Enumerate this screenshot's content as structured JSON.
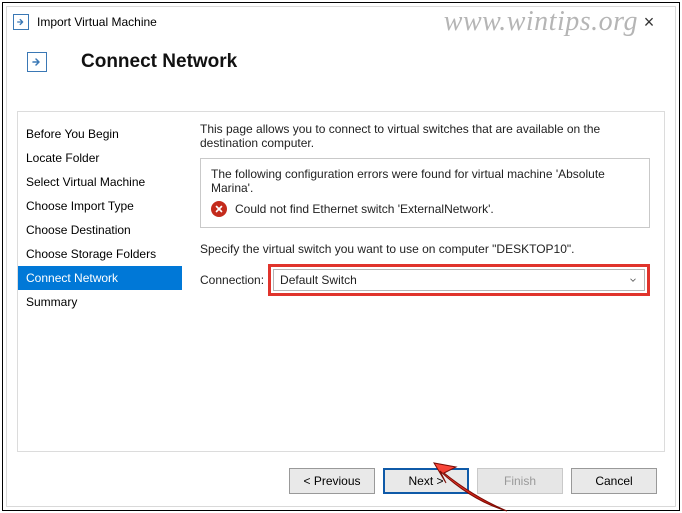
{
  "window": {
    "title": "Import Virtual Machine",
    "page_heading": "Connect Network"
  },
  "sidebar": {
    "items": [
      {
        "label": "Before You Begin",
        "selected": false
      },
      {
        "label": "Locate Folder",
        "selected": false
      },
      {
        "label": "Select Virtual Machine",
        "selected": false
      },
      {
        "label": "Choose Import Type",
        "selected": false
      },
      {
        "label": "Choose Destination",
        "selected": false
      },
      {
        "label": "Choose Storage Folders",
        "selected": false
      },
      {
        "label": "Connect Network",
        "selected": true
      },
      {
        "label": "Summary",
        "selected": false
      }
    ]
  },
  "content": {
    "intro": "This page allows you to connect to virtual switches that are available on the destination computer.",
    "error_heading": "The following configuration errors were found for virtual machine 'Absolute Marina'.",
    "error_detail": "Could not find Ethernet switch 'ExternalNetwork'.",
    "specify_text": "Specify the virtual switch you want to use on computer \"DESKTOP10\".",
    "connection_label": "Connection:",
    "connection_value": "Default Switch"
  },
  "buttons": {
    "previous": "< Previous",
    "next": "Next >",
    "finish": "Finish",
    "cancel": "Cancel"
  },
  "watermark": "www.wintips.org"
}
